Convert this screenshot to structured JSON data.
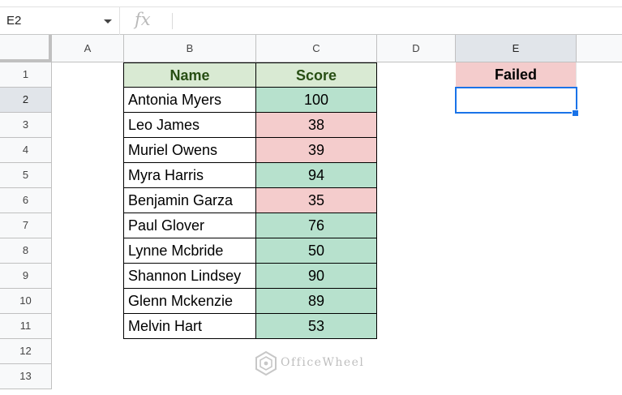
{
  "formula_bar": {
    "name_box": "E2",
    "fx_label": "fx",
    "formula": ""
  },
  "columns": [
    "A",
    "B",
    "C",
    "D",
    "E"
  ],
  "rows": [
    "1",
    "2",
    "3",
    "4",
    "5",
    "6",
    "7",
    "8",
    "9",
    "10",
    "11",
    "12",
    "13"
  ],
  "selected_cell": "E2",
  "table": {
    "headers": {
      "name": "Name",
      "score": "Score"
    },
    "rows": [
      {
        "name": "Antonia Myers",
        "score": "100",
        "status": "pass"
      },
      {
        "name": "Leo James",
        "score": "38",
        "status": "fail"
      },
      {
        "name": "Muriel Owens",
        "score": "39",
        "status": "fail"
      },
      {
        "name": "Myra Harris",
        "score": "94",
        "status": "pass"
      },
      {
        "name": "Benjamin Garza",
        "score": "35",
        "status": "fail"
      },
      {
        "name": "Paul Glover",
        "score": "76",
        "status": "pass"
      },
      {
        "name": "Lynne Mcbride",
        "score": "50",
        "status": "pass"
      },
      {
        "name": "Shannon Lindsey",
        "score": "90",
        "status": "pass"
      },
      {
        "name": "Glenn Mckenzie",
        "score": "89",
        "status": "pass"
      },
      {
        "name": "Melvin Hart",
        "score": "53",
        "status": "pass"
      }
    ]
  },
  "failed_header": "Failed",
  "watermark": "OfficeWheel",
  "colors": {
    "header_fill": "#d9ead3",
    "header_text": "#274e13",
    "pass_fill": "#b7e1cd",
    "fail_fill": "#f4cccc",
    "selection": "#1a73e8"
  }
}
